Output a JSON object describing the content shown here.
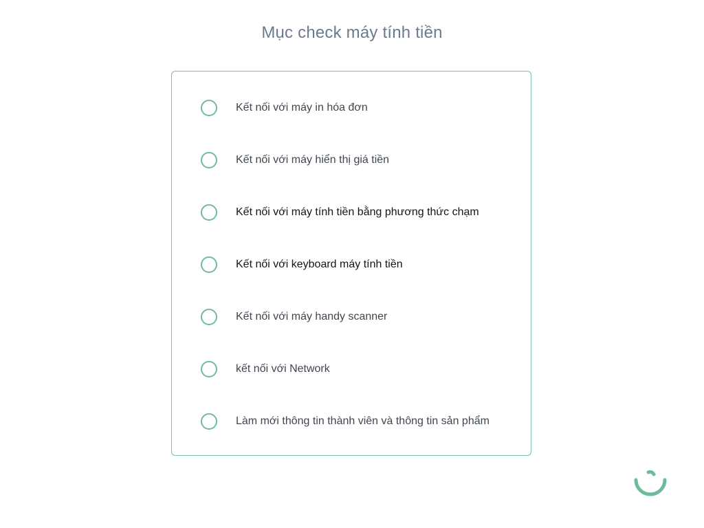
{
  "page": {
    "title": "Mục check máy tính tiền"
  },
  "checklist": {
    "items": [
      {
        "label": "Kết nối với máy in hóa đơn",
        "checked": false,
        "tone": "muted"
      },
      {
        "label": "Kết nối với máy hiển thị giá tiền",
        "checked": false,
        "tone": "muted"
      },
      {
        "label": "Kết nối với máy tính tiền bằng phương thức chạm",
        "checked": false,
        "tone": "dark"
      },
      {
        "label": "Kết nối với keyboard máy tính tiền",
        "checked": false,
        "tone": "dark"
      },
      {
        "label": "Kết nối với máy handy scanner",
        "checked": false,
        "tone": "muted"
      },
      {
        "label": "kết nối với Network",
        "checked": false,
        "tone": "muted"
      },
      {
        "label": "Làm mới thông tin thành viên và thông tin sản phẩm",
        "checked": false,
        "tone": "muted"
      }
    ]
  },
  "colors": {
    "accent": "#6dbb9b",
    "border": "#7cbfa6",
    "title": "#6b7a8f"
  },
  "icons": {
    "status": "loading-smile-icon"
  }
}
